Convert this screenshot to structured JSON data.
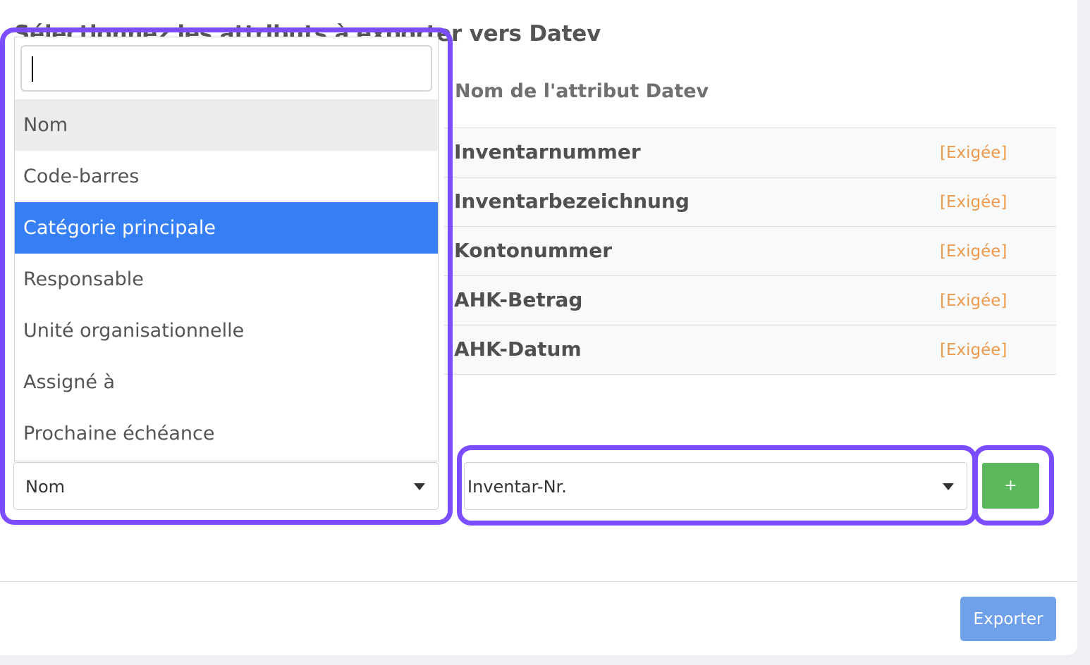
{
  "heading": "Sélectionnez les attributs à exporter vers Datev",
  "table": {
    "column_header": "Nom de l'attribut Datev",
    "rows": [
      {
        "name": "Inventarnummer",
        "tag": "[Exigée]"
      },
      {
        "name": "Inventarbezeichnung",
        "tag": "[Exigée]"
      },
      {
        "name": "Kontonummer",
        "tag": "[Exigée]"
      },
      {
        "name": "AHK-Betrag",
        "tag": "[Exigée]"
      },
      {
        "name": "AHK-Datum",
        "tag": "[Exigée]"
      }
    ]
  },
  "attribute_select": {
    "selected": "Nom",
    "search_value": "",
    "options": [
      {
        "label": "Nom",
        "state": "hover"
      },
      {
        "label": "Code-barres",
        "state": ""
      },
      {
        "label": "Catégorie principale",
        "state": "active"
      },
      {
        "label": "Responsable",
        "state": ""
      },
      {
        "label": "Unité organisationnelle",
        "state": ""
      },
      {
        "label": "Assigné à",
        "state": ""
      },
      {
        "label": "Prochaine échéance",
        "state": ""
      }
    ]
  },
  "datev_select": {
    "selected": "Inventar-Nr."
  },
  "add_button": {
    "label": "+"
  },
  "export_button": {
    "label": "Exporter"
  },
  "colors": {
    "highlight": "#7c4dff",
    "active_option": "#357ef4",
    "add_button": "#5cb85c",
    "export_button": "#6fa0ea",
    "required_tag": "#ee9a4c"
  }
}
